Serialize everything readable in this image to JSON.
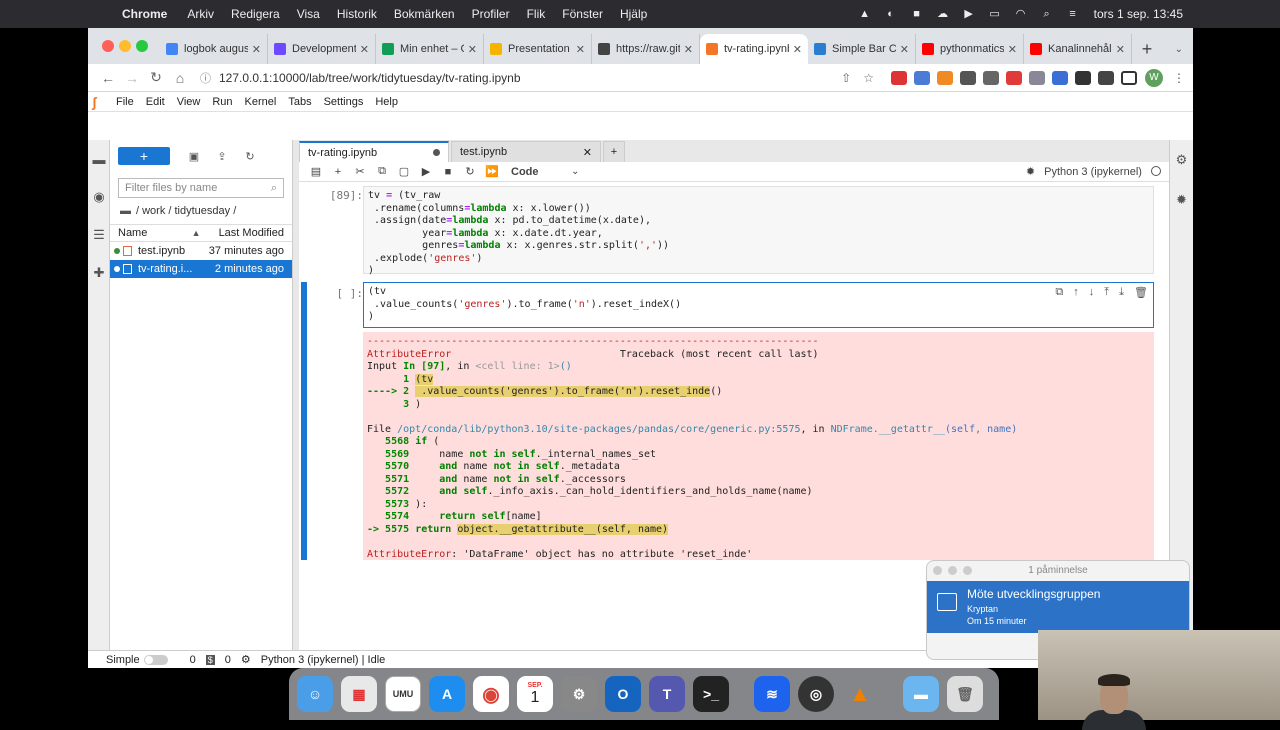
{
  "menubar": {
    "app": "Chrome",
    "items": [
      "Arkiv",
      "Redigera",
      "Visa",
      "Historik",
      "Bokmärken",
      "Profiler",
      "Flik",
      "Fönster",
      "Hjälp"
    ],
    "clock": "tors 1 sep.  13:45"
  },
  "chrome": {
    "tabs": [
      {
        "title": "logbok augusti",
        "color": "#4285f4"
      },
      {
        "title": "Development",
        "color": "#6d4aff"
      },
      {
        "title": "Min enhet – G",
        "color": "#0f9d58"
      },
      {
        "title": "Presentation S",
        "color": "#f4b400"
      },
      {
        "title": "https://raw.git",
        "color": "#444444"
      },
      {
        "title": "tv-rating.ipynb",
        "color": "#f37626"
      },
      {
        "title": "Simple Bar Ch",
        "color": "#2b7cd3"
      },
      {
        "title": "pythonmatics",
        "color": "#ff0000"
      },
      {
        "title": "Kanalinnehåll",
        "color": "#ff0000"
      }
    ],
    "url": "127.0.0.1:10000/lab/tree/work/tidytuesday/tv-rating.ipynb",
    "profile_initial": "W"
  },
  "jupyter": {
    "menu": [
      "File",
      "Edit",
      "View",
      "Run",
      "Kernel",
      "Tabs",
      "Settings",
      "Help"
    ],
    "new_label": "+",
    "filter_placeholder": "Filter files by name",
    "breadcrumb": "/ work / tidytuesday /",
    "col_name": "Name",
    "col_modified": "Last Modified",
    "files": [
      {
        "name": "test.ipynb",
        "modified": "37 minutes ago",
        "selected": false
      },
      {
        "name": "tv-rating.i...",
        "modified": "2 minutes ago",
        "selected": true
      }
    ],
    "nb_tabs": [
      "tv-rating.ipynb",
      "test.ipynb"
    ],
    "cell_type": "Code",
    "kernel_name": "Python 3 (ipykernel)",
    "cell1_prompt": "[89]:",
    "cell2_prompt": "[ ]:",
    "error": {
      "name": "AttributeError",
      "traceback_title": "Traceback (most recent call last)",
      "message": ": 'DataFrame' object has no attribute 'reset_inde'"
    },
    "status": {
      "mode": "Simple",
      "count1": "0",
      "count2": "0",
      "kernel": "Python 3 (ipykernel) | Idle"
    }
  },
  "notification": {
    "header": "1 påminnelse",
    "title": "Möte utvecklingsgruppen",
    "subtitle": "Kryptan",
    "time": "Om 15 minuter"
  },
  "dock": {
    "calendar_month": "SEP.",
    "calendar_day": "1"
  }
}
